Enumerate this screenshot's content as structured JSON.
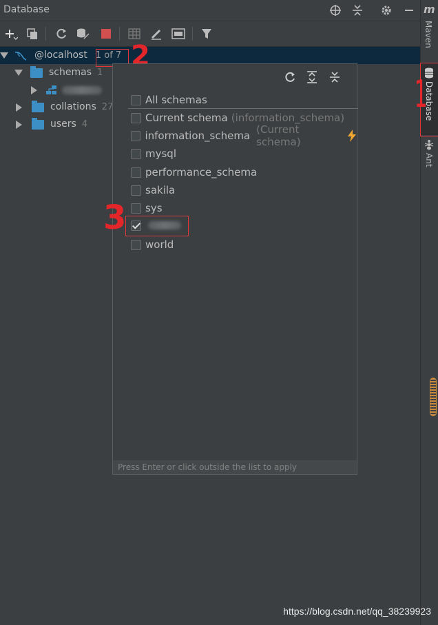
{
  "window": {
    "title": "Database"
  },
  "tree": {
    "root": {
      "label": "@localhost",
      "badge": "1 of 7"
    },
    "schemas": {
      "label": "schemas",
      "count": "1"
    },
    "collations": {
      "label": "collations",
      "count": "27"
    },
    "users": {
      "label": "users",
      "count": "4"
    }
  },
  "popup": {
    "options": [
      {
        "label": "All schemas",
        "hint": "",
        "checked": false
      },
      {
        "label": "Current schema",
        "hint": "(information_schema)",
        "checked": false
      },
      {
        "label": "information_schema",
        "hint": "(Current schema)",
        "checked": false
      },
      {
        "label": "mysql",
        "hint": "",
        "checked": false
      },
      {
        "label": "performance_schema",
        "hint": "",
        "checked": false
      },
      {
        "label": "sakila",
        "hint": "",
        "checked": false
      },
      {
        "label": "sys",
        "hint": "",
        "checked": false
      },
      {
        "label": "",
        "hint": "",
        "checked": true
      },
      {
        "label": "world",
        "hint": "",
        "checked": false
      }
    ],
    "footer": "Press Enter or click outside the list to apply"
  },
  "strip": {
    "maven": "Maven",
    "maven_logo": "m",
    "database": "Database",
    "ant": "Ant"
  },
  "annotations": {
    "a1": "1",
    "a2": "2",
    "a3": "3"
  },
  "watermark": "https://blog.csdn.net/qq_38239923",
  "colors": {
    "background": "#3c3f41",
    "selection": "#0d293e",
    "folder": "#3b8fc4",
    "stop": "#d24f4f",
    "annotation": "#e3262a",
    "bolt": "#f0a732"
  }
}
